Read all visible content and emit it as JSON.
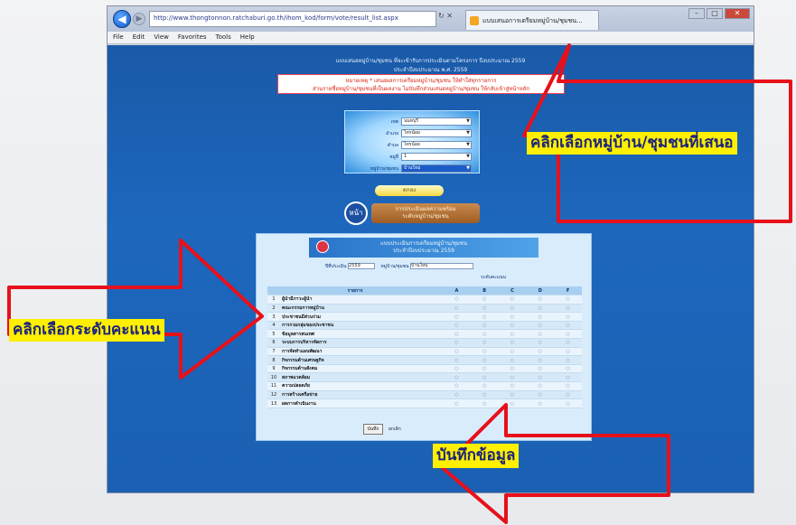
{
  "browser": {
    "address": "http://www.thongtonnon.ratchaburi.go.th/ihom_kod/form/vote/result_list.aspx",
    "tab_title": "แบบเสนอการเตรียมหมู่บ้าน/ชุมชน...",
    "menu": [
      "File",
      "Edit",
      "View",
      "Favorites",
      "Tools",
      "Help"
    ]
  },
  "page": {
    "header_line1": "แบบเสนอหมู่บ้าน/ชุมชน ที่จะเข้ารับการประเมินตามโครงการ ปีงบประมาณ 2559",
    "header_line2": "ประจำปีงบประมาณ พ.ศ. 2559",
    "warning_line1": "หมายเหตุ * เสนอผลการเตรียมหมู่บ้าน/ชุมชน ให้ทำใส่ทุกรายการ",
    "warning_line2": "ส่วนรายชื่อหมู่บ้าน/ชุมชนที่เป็นผลงาน ไม่บันทึกส่วนเสนอหมู่บ้าน/ชุมชน ให้กลับเข้าสู่หน้าหลัก",
    "selects": [
      {
        "label": "เขต",
        "value": "นนทบุรี"
      },
      {
        "label": "อำเภอ",
        "value": "ไทรน้อย"
      },
      {
        "label": "ตำบล",
        "value": "ไทรน้อย"
      },
      {
        "label": "หมู่ที่",
        "value": "1"
      },
      {
        "label": "หมู่บ้าน/ชุมชน",
        "value": "บ้านใหม่"
      }
    ],
    "yellow_button": "ตกลง",
    "link_icon": "หน้า",
    "link_line1": "การประเมินผลความพร้อม",
    "link_line2": "ระดับหมู่บ้าน/ชุมชน"
  },
  "form": {
    "banner_line1": "แบบประเมินการเตรียมหมู่บ้าน/ชุมชน",
    "banner_line2": "ประจำปีงบประมาณ 2559",
    "year_label": "ปีที่ประเมิน",
    "year_value": "2559",
    "village_label": "หมู่บ้าน/ชุมชน",
    "village_value": "บ้านใหม่",
    "level_caption": "ระดับคะแนน",
    "col_item": "รายการ",
    "col_score": "คะแนน",
    "levels": [
      "A",
      "B",
      "C",
      "D",
      "F"
    ],
    "rows": [
      {
        "n": "1",
        "t": "ผู้นำมีภาวะผู้นำ"
      },
      {
        "n": "2",
        "t": "คณะกรรมการหมู่บ้าน"
      },
      {
        "n": "3",
        "t": "ประชาชนมีส่วนร่วม"
      },
      {
        "n": "4",
        "t": "การรวมกลุ่มของประชาชน"
      },
      {
        "n": "5",
        "t": "ข้อมูลสารสนเทศ"
      },
      {
        "n": "6",
        "t": "ระบบการบริหารจัดการ"
      },
      {
        "n": "7",
        "t": "การจัดทำแผนพัฒนา"
      },
      {
        "n": "8",
        "t": "กิจกรรมด้านเศรษฐกิจ"
      },
      {
        "n": "9",
        "t": "กิจกรรมด้านสังคม"
      },
      {
        "n": "10",
        "t": "สภาพแวดล้อม"
      },
      {
        "n": "11",
        "t": "ความปลอดภัย"
      },
      {
        "n": "12",
        "t": "การสร้างเครือข่าย"
      },
      {
        "n": "13",
        "t": "ผลการดำเนินงาน"
      }
    ],
    "save_label": "บันทึก",
    "reset_label": "ยกเลิก"
  },
  "callouts": {
    "select_village": "คลิกเลือกหมู่บ้าน/ชุมชนที่เสนอ",
    "select_level": "คลิกเลือกระดับคะแนน",
    "save": "บันทึกข้อมูล"
  },
  "colors": {
    "page_bg": "#1b60b2",
    "arrow_red": "#e8101a",
    "callout_yellow": "#ffef00",
    "callout_text": "#1a237e"
  }
}
